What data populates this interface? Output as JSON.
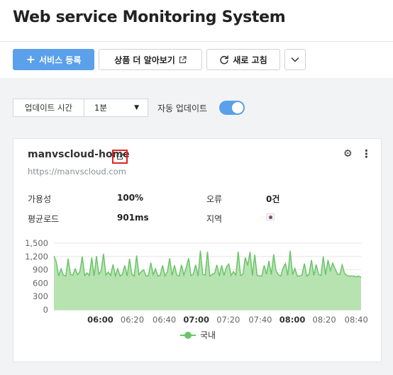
{
  "app": {
    "title": "Web service Monitoring System"
  },
  "toolbar": {
    "add_label": "서비스 등록",
    "more_label": "상품 더 알아보기",
    "refresh_label": "새로 고침"
  },
  "controls": {
    "interval_label": "업데이트 시간",
    "interval_value": "1분",
    "auto_update_label": "자동 업데이트",
    "auto_update_on": true
  },
  "service": {
    "name": "manvscloud-home",
    "url": "https://manvscloud.com",
    "stats": {
      "availability_label": "가용성",
      "availability_value": "100%",
      "error_label": "오류",
      "error_value": "0건",
      "avg_load_label": "평균로드",
      "avg_load_value": "901ms",
      "region_label": "지역"
    }
  },
  "colors": {
    "accent": "#5aa0ea",
    "series": "#6cc46a",
    "highlight": "#e02424"
  },
  "chart_data": {
    "type": "area",
    "yticks": [
      "0",
      "300",
      "600",
      "900",
      "1,200",
      "1,500"
    ],
    "ylim": [
      0,
      1500
    ],
    "xticks": [
      "06:00",
      "06:20",
      "06:40",
      "07:00",
      "07:20",
      "07:40",
      "08:00",
      "08:20",
      "08:40"
    ],
    "xticks_bold": [
      true,
      false,
      false,
      true,
      false,
      false,
      true,
      false,
      false
    ],
    "x_start_minutes": 331,
    "x_end_minutes": 523,
    "series": [
      {
        "name": "국내",
        "values": [
          1210,
          1080,
          760,
          920,
          780,
          760,
          1150,
          800,
          780,
          920,
          790,
          860,
          1200,
          770,
          830,
          770,
          1180,
          760,
          1210,
          800,
          880,
          1260,
          780,
          850,
          770,
          1020,
          760,
          920,
          760,
          800,
          1000,
          760,
          1150,
          800,
          760,
          1220,
          790,
          860,
          900,
          760,
          770,
          1060,
          790,
          920,
          760,
          780,
          1000,
          760,
          850,
          1160,
          770,
          1000,
          780,
          760,
          1010,
          780,
          950,
          1160,
          770,
          800,
          1010,
          760,
          1330,
          800,
          780,
          1310,
          760,
          800,
          820,
          1010,
          760,
          1000,
          770,
          960,
          1030,
          770,
          860,
          780,
          1310,
          770,
          800,
          1180,
          1000,
          1300,
          770,
          1240,
          780,
          760,
          760,
          1000,
          800,
          1100,
          790,
          1250,
          880,
          790,
          760,
          940,
          1040,
          770,
          1330,
          790,
          930,
          760,
          760,
          780,
          1040,
          760,
          800,
          1120,
          770,
          1020,
          800,
          770,
          1200,
          790,
          1120,
          880,
          1050,
          920,
          800,
          790,
          1010,
          820,
          770,
          760,
          760,
          760,
          740,
          760,
          730
        ]
      }
    ]
  }
}
